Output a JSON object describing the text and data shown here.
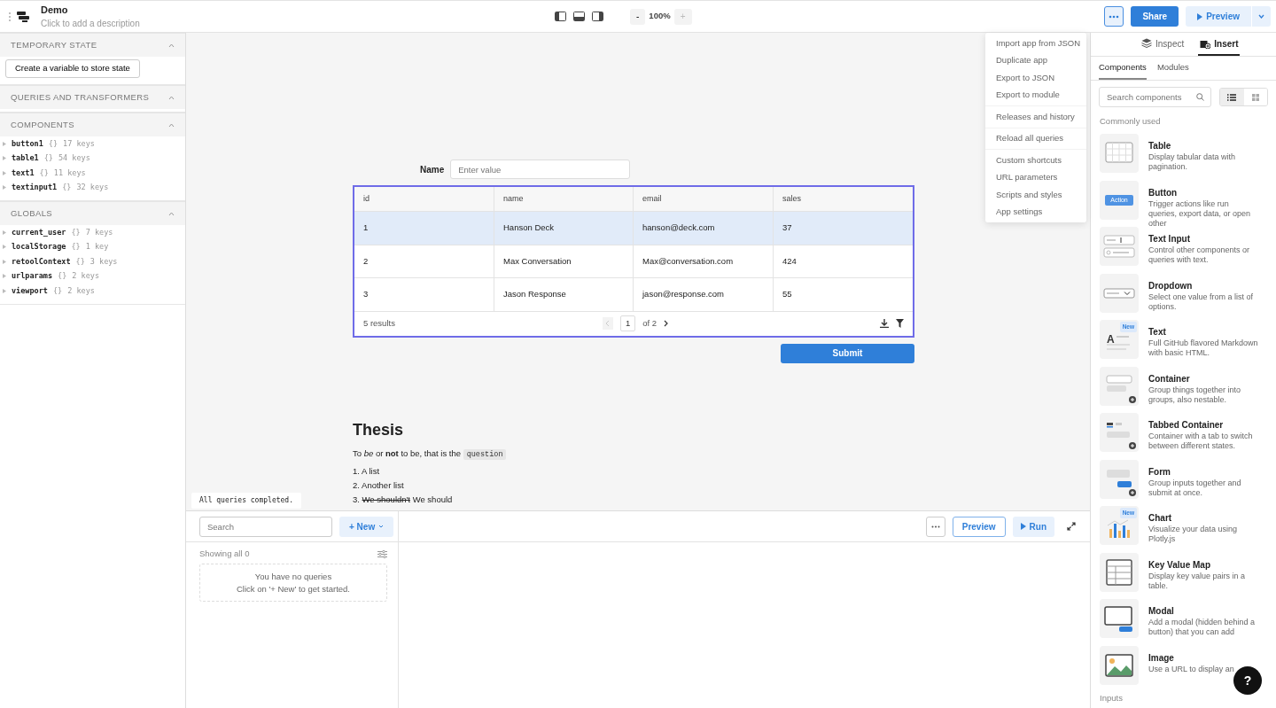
{
  "app": {
    "title": "Demo",
    "description": "Click to add a description"
  },
  "zoom": {
    "minus": "-",
    "value": "100%",
    "plus": "+",
    "plus_disabled": true
  },
  "header_buttons": {
    "more_selected": true,
    "share": "Share",
    "preview": "Preview"
  },
  "more_menu": {
    "groups": [
      [
        "Import app from JSON",
        "Duplicate app",
        "Export to JSON",
        "Export to module"
      ],
      [
        "Releases and history"
      ],
      [
        "Reload all queries"
      ],
      [
        "Custom shortcuts",
        "URL parameters",
        "Scripts and styles",
        "App settings"
      ]
    ]
  },
  "sidebar": {
    "sections": [
      {
        "title": "TEMPORARY STATE",
        "expanded": true,
        "button": "Create a variable to store state"
      },
      {
        "title": "QUERIES AND TRANSFORMERS",
        "expanded": true
      },
      {
        "title": "COMPONENTS",
        "expanded": true,
        "items": [
          {
            "name": "button1",
            "braces": "{}",
            "keys": "17 keys"
          },
          {
            "name": "table1",
            "braces": "{}",
            "keys": "54 keys"
          },
          {
            "name": "text1",
            "braces": "{}",
            "keys": "11 keys"
          },
          {
            "name": "textinput1",
            "braces": "{}",
            "keys": "32 keys"
          }
        ]
      },
      {
        "title": "GLOBALS",
        "expanded": true,
        "items": [
          {
            "name": "current_user",
            "braces": "{}",
            "keys": "7 keys"
          },
          {
            "name": "localStorage",
            "braces": "{}",
            "keys": "1 key"
          },
          {
            "name": "retoolContext",
            "braces": "{}",
            "keys": "3 keys"
          },
          {
            "name": "urlparams",
            "braces": "{}",
            "keys": "2 keys"
          },
          {
            "name": "viewport",
            "braces": "{}",
            "keys": "2 keys"
          }
        ]
      }
    ]
  },
  "canvas": {
    "name_label": "Name",
    "name_placeholder": "Enter value",
    "table": {
      "columns": [
        "id",
        "name",
        "email",
        "sales"
      ],
      "rows": [
        {
          "selected": true,
          "cells": [
            "1",
            "Hanson Deck",
            "hanson@deck.com",
            "37"
          ]
        },
        {
          "selected": false,
          "cells": [
            "2",
            "Max Conversation",
            "Max@conversation.com",
            "424"
          ]
        },
        {
          "selected": false,
          "cells": [
            "3",
            "Jason Response",
            "jason@response.com",
            "55"
          ]
        }
      ],
      "footer": {
        "results": "5 results",
        "page": "1",
        "of": "of 2"
      }
    },
    "submit": "Submit",
    "text_block": {
      "heading": "Thesis",
      "paragraph": "To *be* or **not** to be, that is the",
      "code": "question",
      "list": [
        {
          "number": "1.",
          "text": "A list"
        },
        {
          "number": "2.",
          "text": "Another list"
        },
        {
          "number": "3.",
          "struck": "We shouldn't",
          "text": "We should"
        }
      ]
    }
  },
  "status_tag": "All queries completed.",
  "query_panel": {
    "search_placeholder": "Search",
    "new_button": "+ New",
    "count": "Showing all 0",
    "empty": [
      "You have no queries",
      "Click on '+ New' to get started."
    ],
    "preview": "Preview",
    "run": "Run"
  },
  "right_panel": {
    "tabs": [
      {
        "label": "Inspect",
        "kind": "inspect",
        "selected": false
      },
      {
        "label": "Insert",
        "kind": "insert",
        "selected": true
      }
    ],
    "subtabs": [
      {
        "label": "Components",
        "selected": true
      },
      {
        "label": "Modules",
        "selected": false
      }
    ],
    "search_placeholder": "Search components",
    "views": [
      {
        "kind": "list",
        "selected": true
      },
      {
        "kind": "grid",
        "selected": false
      }
    ],
    "section": "Commonly used",
    "components": [
      {
        "kind": "table",
        "title": "Table",
        "description": "Display tabular data with pagination."
      },
      {
        "kind": "button",
        "title": "Button",
        "description": "Trigger actions like run queries, export data, or open other",
        "icon_label": "Action"
      },
      {
        "kind": "textinput",
        "title": "Text Input",
        "description": "Control other components or queries with text."
      },
      {
        "kind": "dropdown",
        "title": "Dropdown",
        "description": "Select one value from a list of options."
      },
      {
        "kind": "text",
        "title": "Text",
        "description": "Full GitHub flavored Markdown with basic HTML.",
        "icon_label": "A",
        "badge": "New"
      },
      {
        "kind": "container",
        "title": "Container",
        "description": "Group things together into groups, also nestable."
      },
      {
        "kind": "tabbed",
        "title": "Tabbed Container",
        "description": "Container with a tab to switch between different states."
      },
      {
        "kind": "form",
        "title": "Form",
        "description": "Group inputs together and submit at once."
      },
      {
        "kind": "chart",
        "title": "Chart",
        "description": "Visualize your data using Plotly.js",
        "badge": "New"
      },
      {
        "kind": "kvmap",
        "title": "Key Value Map",
        "description": "Display key value pairs in a table."
      },
      {
        "kind": "modal",
        "title": "Modal",
        "description": "Add a modal (hidden behind a button) that you can add"
      },
      {
        "kind": "image",
        "title": "Image",
        "description": "Use a URL to display an"
      }
    ],
    "next_section": "Inputs"
  },
  "help": "?"
}
